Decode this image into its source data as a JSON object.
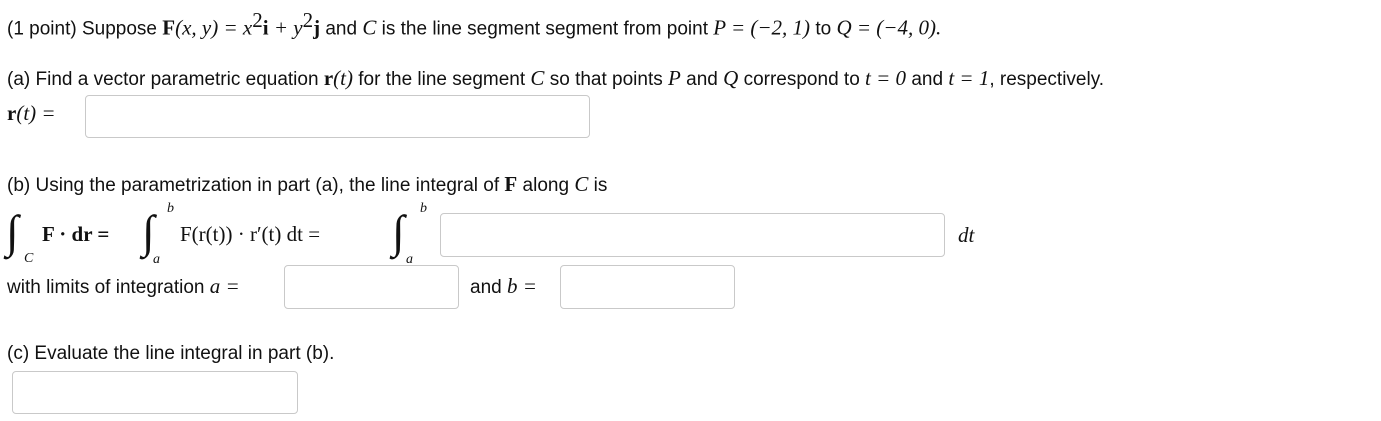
{
  "question": {
    "points": "(1 point) Suppose",
    "F": "F",
    "of_xy": "(x, y) = x",
    "sq": "2",
    "i": "i",
    "plus_y": " + y",
    "sq2": "2",
    "j": "j",
    "and_text": "and",
    "C": "C",
    "seg_text": "is the line segment segment from point",
    "P_expr": "P = (−2, 1)",
    "to_text": "to",
    "Q_expr": "Q = (−4, 0)."
  },
  "part_a": {
    "intro": "(a) Find a vector parametric equation",
    "r": "r",
    "of_t": "(t)",
    "for_text": "for the line segment",
    "C": "C",
    "so_text": "so that points",
    "P": "P",
    "and_text": "and",
    "Q": "Q",
    "corr_text": "correspond to",
    "t0": "t = 0",
    "and2": "and",
    "t1": "t = 1",
    "resp": ", respectively.",
    "lhs_r": "r",
    "lhs_rest": "(t) =",
    "answer_value": ""
  },
  "part_b": {
    "intro": "(b) Using the parametrization in part (a), the line integral of",
    "F": "F",
    "along": "along",
    "C": "C",
    "is": "is",
    "int_sub_C": "C",
    "F_dot": "F · dr =",
    "upper_b1": "b",
    "lower_a1": "a",
    "middle": "F(r(t)) · r′(t) dt =",
    "upper_b2": "b",
    "lower_a2": "a",
    "dt": "dt",
    "limits_text": "with limits of integration",
    "a_eq": "a =",
    "and_text": "and",
    "b_eq": "b =",
    "integrand_value": "",
    "a_value": "",
    "b_value": ""
  },
  "part_c": {
    "intro": "(c) Evaluate the line integral in part (b).",
    "answer_value": ""
  }
}
